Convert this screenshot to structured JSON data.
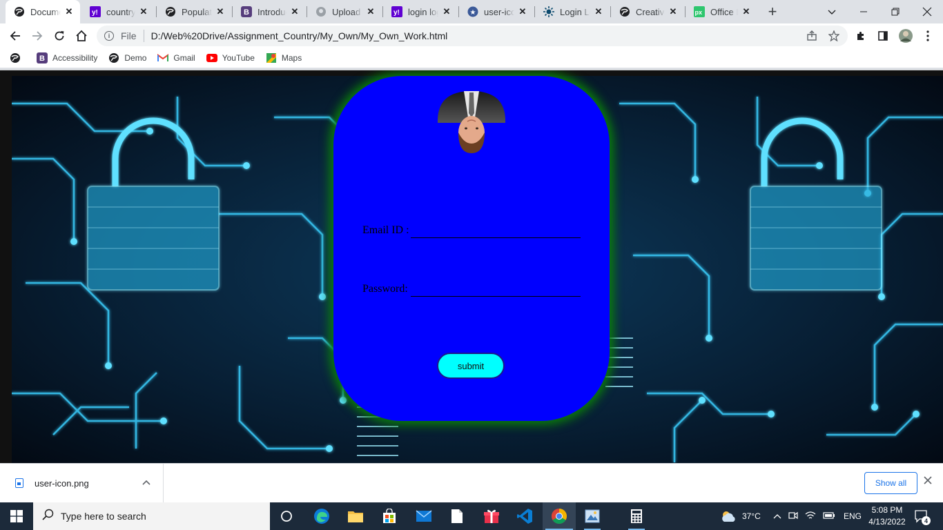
{
  "browser": {
    "tabs": [
      {
        "title": "Docume",
        "icon": "globe-icon",
        "active": true
      },
      {
        "title": "country",
        "icon": "yahoo-icon"
      },
      {
        "title": "Populati",
        "icon": "globe-icon"
      },
      {
        "title": "Introduc",
        "icon": "bootstrap-icon"
      },
      {
        "title": "Upload f",
        "icon": "github-icon"
      },
      {
        "title": "login log",
        "icon": "yahoo-icon"
      },
      {
        "title": "user-icon",
        "icon": "star-circle-icon"
      },
      {
        "title": "Login Lo",
        "icon": "sun-icon"
      },
      {
        "title": "Creative",
        "icon": "globe-icon"
      },
      {
        "title": "Office D",
        "icon": "pixabay-icon"
      }
    ],
    "omnibox": {
      "scheme_label": "File",
      "url": "D:/Web%20Drive/Assignment_Country/My_Own/My_Own_Work.html"
    },
    "bookmarks": [
      {
        "label": "",
        "icon": "globe-icon"
      },
      {
        "label": "Accessibility",
        "icon": "bootstrap-icon"
      },
      {
        "label": "Demo",
        "icon": "globe-icon"
      },
      {
        "label": "Gmail",
        "icon": "gmail-icon"
      },
      {
        "label": "YouTube",
        "icon": "youtube-icon"
      },
      {
        "label": "Maps",
        "icon": "maps-icon"
      }
    ]
  },
  "login": {
    "email_label": "Email ID :",
    "email_value": "",
    "password_label": "Password:",
    "password_value": "",
    "submit_label": "submit",
    "card_color": "#0000ff",
    "glow_color": "#0a7d0a",
    "button_color": "#00ffff"
  },
  "downloads": {
    "filename": "user-icon.png",
    "show_all_label": "Show all"
  },
  "taskbar": {
    "search_placeholder": "Type here to search",
    "weather": "37°C",
    "language": "ENG",
    "time": "5:08 PM",
    "date": "4/13/2022",
    "notification_count": "4"
  }
}
